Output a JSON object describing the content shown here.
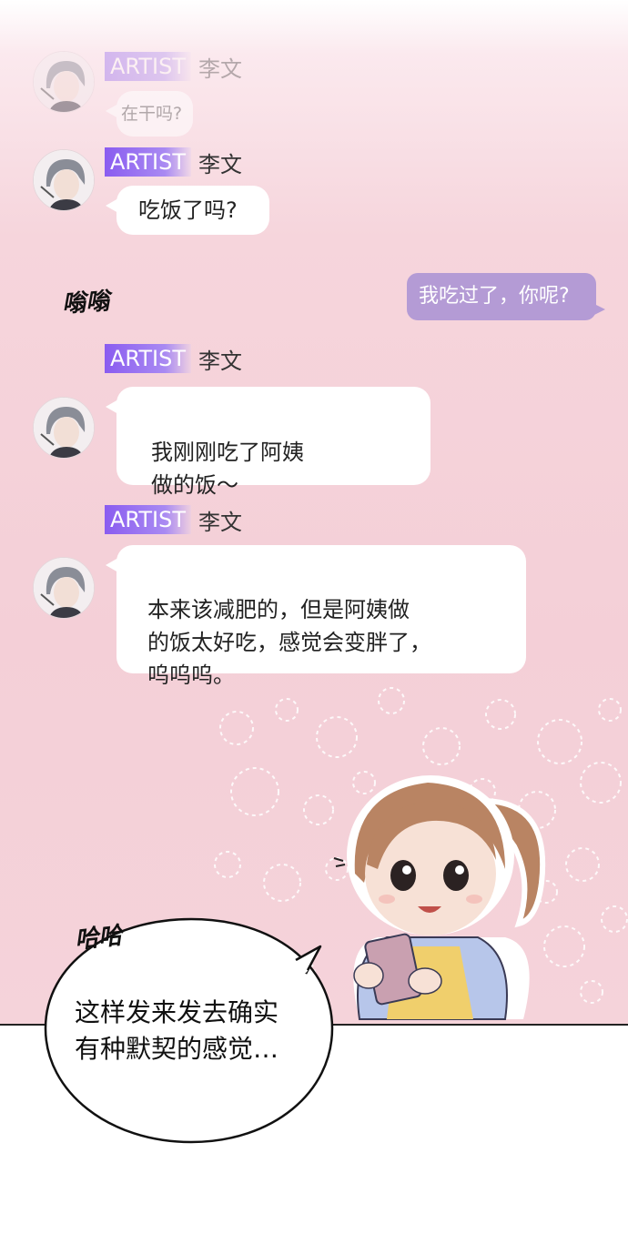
{
  "messages": [
    {
      "artist_tag": "ARTIST",
      "name": "李文",
      "text": "在干吗?"
    },
    {
      "artist_tag": "ARTIST",
      "name": "李文",
      "text": "吃饭了吗?"
    },
    {
      "artist_tag": "ARTIST",
      "name": "李文",
      "text": "我刚刚吃了阿姨\n做的饭～"
    },
    {
      "artist_tag": "ARTIST",
      "name": "李文",
      "text": "本来该减肥的，但是阿姨做\n的饭太好吃，感觉会变胖了，\n呜呜呜。"
    }
  ],
  "reply": {
    "text": "我吃过了，你呢?"
  },
  "sfx": {
    "buzz": "嗡嗡",
    "haha": "哈哈"
  },
  "speech_bubble": {
    "text": "这样发来发去确实\n有种默契的感觉…"
  },
  "colors": {
    "artist_tag": "#8a5cf0",
    "reply_bubble": "#b49bd5",
    "background_pink": "#f4cfd7"
  }
}
